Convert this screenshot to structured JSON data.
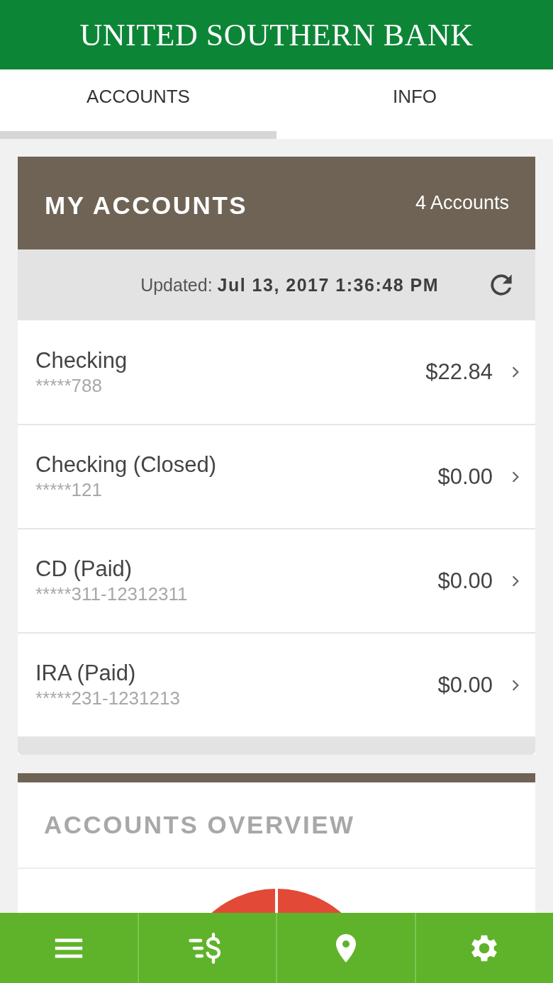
{
  "app_bar": {
    "title": "UNITED SOUTHERN BANK"
  },
  "tabs": [
    {
      "label": "ACCOUNTS",
      "selected": true
    },
    {
      "label": "INFO",
      "selected": false
    }
  ],
  "accounts_card": {
    "title": "MY ACCOUNTS",
    "count": "4 Accounts",
    "updated_label": "Updated:",
    "updated_value": "Jul 13, 2017 1:36:48 PM",
    "accounts": [
      {
        "name": "Checking",
        "number": "*****788",
        "balance": "$22.84"
      },
      {
        "name": "Checking (Closed)",
        "number": "*****121",
        "balance": "$0.00"
      },
      {
        "name": "CD (Paid)",
        "number": "*****311-12312311",
        "balance": "$0.00"
      },
      {
        "name": "IRA (Paid)",
        "number": "*****231-1231213",
        "balance": "$0.00"
      }
    ]
  },
  "overview_card": {
    "title": "ACCOUNTS OVERVIEW"
  },
  "bottom_nav": [
    {
      "kind": "menu"
    },
    {
      "kind": "transfer"
    },
    {
      "kind": "location"
    },
    {
      "kind": "settings"
    }
  ]
}
